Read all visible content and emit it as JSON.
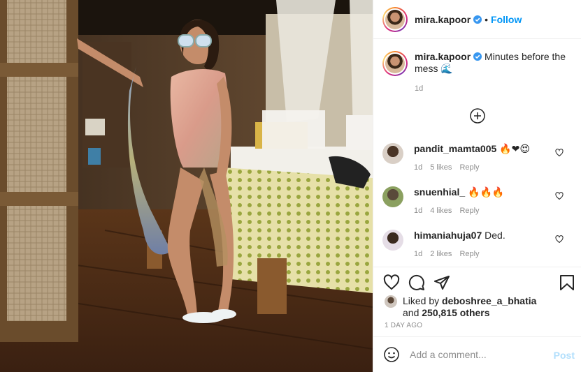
{
  "header": {
    "username": "mira.kapoor",
    "dot": "•",
    "follow_label": "Follow"
  },
  "caption": {
    "username": "mira.kapoor",
    "text": "Minutes before the mess",
    "emoji": "🌊",
    "time": "1d"
  },
  "load_more_icon": "plus-circle-icon",
  "comments": [
    {
      "username": "pandit_mamta005",
      "text": "🔥❤😍",
      "time": "1d",
      "likes": "5 likes",
      "reply": "Reply"
    },
    {
      "username": "snuenhial_",
      "text": "🔥🔥🔥",
      "time": "1d",
      "likes": "4 likes",
      "reply": "Reply"
    },
    {
      "username": "himaniahuja07",
      "text": "Ded.",
      "time": "1d",
      "likes": "2 likes",
      "reply": "Reply"
    }
  ],
  "actions": {
    "liked_prefix": "Liked by",
    "liked_user": "deboshree_a_bhatia",
    "liked_and": "and",
    "others": "250,815 others",
    "timestamp": "1 DAY AGO"
  },
  "add_comment": {
    "placeholder": "Add a comment...",
    "post_label": "Post"
  },
  "colors": {
    "link": "#0095f6",
    "muted": "#8e8e8e",
    "post_disabled": "#b2dffc"
  }
}
